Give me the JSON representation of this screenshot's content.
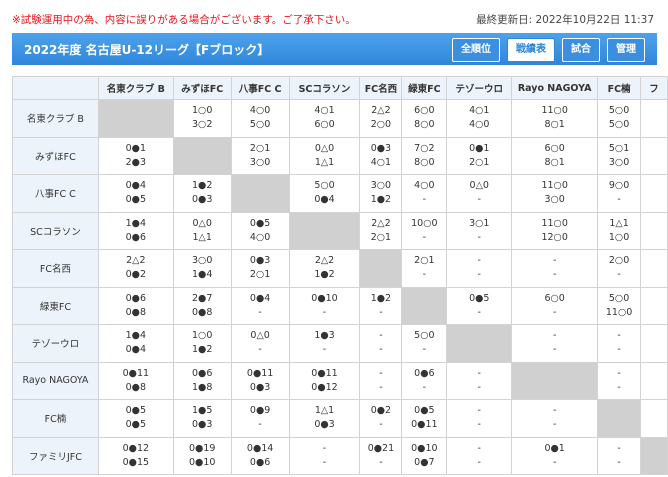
{
  "notice": "※試験運用中の為、内容に誤りがある場合がございます。ご了承下さい。",
  "last_updated": "最終更新日: 2022年10月22日 11:37",
  "header": {
    "title": "2022年度 名古屋U-12リーグ【Fブロック】",
    "tabs": [
      "全順位",
      "戦績表",
      "試合",
      "管理"
    ],
    "active_tab": 1
  },
  "colors": {
    "header_blue": "#2f86da",
    "notice_red": "#e8141b",
    "self_cell": "#d0d0d0",
    "head_bg": "#ecf3fa"
  },
  "teams": [
    "名東クラブ B",
    "みずほFC",
    "八事FC C",
    "SCコラソン",
    "FC名西",
    "緑東FC",
    "テゾーウロ",
    "Rayo NAGOYA",
    "FC楠",
    "ファミリJFC"
  ],
  "column_headers": [
    "名東クラブ B",
    "みずほFC",
    "八事FC C",
    "SCコラソン",
    "FC名西",
    "緑東FC",
    "テゾーウロ",
    "Rayo NAGOYA",
    "FC楠",
    "フ"
  ],
  "results": [
    [
      null,
      [
        "1○0",
        "3○2"
      ],
      [
        "4○0",
        "5○0"
      ],
      [
        "4○1",
        "6○0"
      ],
      [
        "2△2",
        "2○0"
      ],
      [
        "6○0",
        "8○0"
      ],
      [
        "4○1",
        "4○0"
      ],
      [
        "11○0",
        "8○1"
      ],
      [
        "5○0",
        "5○0"
      ],
      [
        "",
        ""
      ]
    ],
    [
      [
        "0●1",
        "2●3"
      ],
      null,
      [
        "2○1",
        "3○0"
      ],
      [
        "0△0",
        "1△1"
      ],
      [
        "0●3",
        "4○1"
      ],
      [
        "7○2",
        "8○0"
      ],
      [
        "0●1",
        "2○1"
      ],
      [
        "6○0",
        "8○1"
      ],
      [
        "5○1",
        "3○0"
      ],
      [
        "",
        ""
      ]
    ],
    [
      [
        "0●4",
        "0●5"
      ],
      [
        "1●2",
        "0●3"
      ],
      null,
      [
        "5○0",
        "0●4"
      ],
      [
        "3○0",
        "1●2"
      ],
      [
        "4○0",
        "-"
      ],
      [
        "0△0",
        "-"
      ],
      [
        "11○0",
        "3○0"
      ],
      [
        "9○0",
        "-"
      ],
      [
        "",
        ""
      ]
    ],
    [
      [
        "1●4",
        "0●6"
      ],
      [
        "0△0",
        "1△1"
      ],
      [
        "0●5",
        "4○0"
      ],
      null,
      [
        "2△2",
        "2○1"
      ],
      [
        "10○0",
        "-"
      ],
      [
        "3○1",
        "-"
      ],
      [
        "11○0",
        "12○0"
      ],
      [
        "1△1",
        "1○0"
      ],
      [
        "",
        ""
      ]
    ],
    [
      [
        "2△2",
        "0●2"
      ],
      [
        "3○0",
        "1●4"
      ],
      [
        "0●3",
        "2○1"
      ],
      [
        "2△2",
        "1●2"
      ],
      null,
      [
        "2○1",
        "-"
      ],
      [
        "-",
        "-"
      ],
      [
        "-",
        "-"
      ],
      [
        "2○0",
        "-"
      ],
      [
        "",
        ""
      ]
    ],
    [
      [
        "0●6",
        "0●8"
      ],
      [
        "2●7",
        "0●8"
      ],
      [
        "0●4",
        "-"
      ],
      [
        "0●10",
        "-"
      ],
      [
        "1●2",
        "-"
      ],
      null,
      [
        "0●5",
        "-"
      ],
      [
        "6○0",
        "-"
      ],
      [
        "5○0",
        "11○0"
      ],
      [
        "",
        ""
      ]
    ],
    [
      [
        "1●4",
        "0●4"
      ],
      [
        "1○0",
        "1●2"
      ],
      [
        "0△0",
        "-"
      ],
      [
        "1●3",
        "-"
      ],
      [
        "-",
        "-"
      ],
      [
        "5○0",
        "-"
      ],
      null,
      [
        "-",
        "-"
      ],
      [
        "-",
        "-"
      ],
      [
        "",
        ""
      ]
    ],
    [
      [
        "0●11",
        "0●8"
      ],
      [
        "0●6",
        "1●8"
      ],
      [
        "0●11",
        "0●3"
      ],
      [
        "0●11",
        "0●12"
      ],
      [
        "-",
        "-"
      ],
      [
        "0●6",
        "-"
      ],
      [
        "-",
        "-"
      ],
      null,
      [
        "-",
        "-"
      ],
      [
        "",
        ""
      ]
    ],
    [
      [
        "0●5",
        "0●5"
      ],
      [
        "1●5",
        "0●3"
      ],
      [
        "0●9",
        "-"
      ],
      [
        "1△1",
        "0●3"
      ],
      [
        "0●2",
        "-"
      ],
      [
        "0●5",
        "0●11"
      ],
      [
        "-",
        "-"
      ],
      [
        "-",
        "-"
      ],
      null,
      [
        "",
        ""
      ]
    ],
    [
      [
        "0●12",
        "0●15"
      ],
      [
        "0●19",
        "0●10"
      ],
      [
        "0●14",
        "0●6"
      ],
      [
        "-",
        "-"
      ],
      [
        "0●21",
        "-"
      ],
      [
        "0●10",
        "0●7"
      ],
      [
        "-",
        "-"
      ],
      [
        "0●1",
        "-"
      ],
      [
        "-",
        "-"
      ],
      null
    ]
  ]
}
